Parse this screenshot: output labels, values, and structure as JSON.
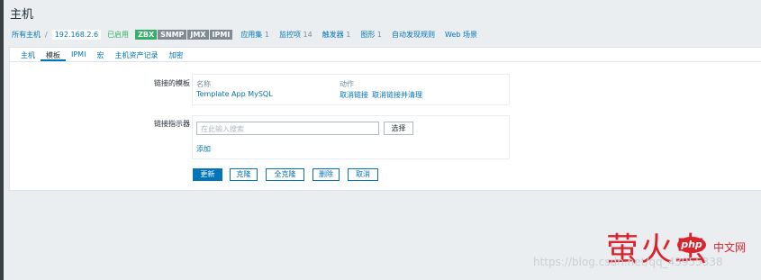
{
  "page": {
    "title": "主机"
  },
  "breadcrumb": {
    "all_hosts": "所有主机",
    "separator": "/",
    "host": "192.168.2.6",
    "status": "已启用",
    "tags": [
      "ZBX",
      "SNMP",
      "JMX",
      "IPMI"
    ],
    "links": [
      {
        "label": "应用集",
        "count": "1"
      },
      {
        "label": "监控项",
        "count": "14"
      },
      {
        "label": "触发器",
        "count": "1"
      },
      {
        "label": "图形",
        "count": "1"
      },
      {
        "label": "自动发现规则",
        "count": ""
      },
      {
        "label": "Web 场景",
        "count": ""
      }
    ]
  },
  "tabs": [
    "主机",
    "模板",
    "IPMI",
    "宏",
    "主机资产记录",
    "加密"
  ],
  "form": {
    "linked_templates_label": "链接的模板",
    "col_name": "名称",
    "col_action": "动作",
    "template_name": "Template App MySQL",
    "unlink": "取消链接",
    "unlink_clear": "取消链接并清理",
    "link_indicator_label": "链接指示器",
    "search_placeholder": "在此输入搜索",
    "choose_button": "选择",
    "add_link": "添加"
  },
  "buttons": {
    "update": "更新",
    "clone": "克隆",
    "full_clone": "全克隆",
    "delete": "删除",
    "cancel": "取消"
  },
  "watermark": {
    "brand": "萤火虫",
    "php": "php",
    "cn": "中文网",
    "url": "https://blog.csdn.net/qq_43955338"
  },
  "colors": {
    "accent": "#0275b8",
    "enabled": "#34af67",
    "tag_gray": "#7f8b91",
    "watermark": "#d9232d"
  }
}
